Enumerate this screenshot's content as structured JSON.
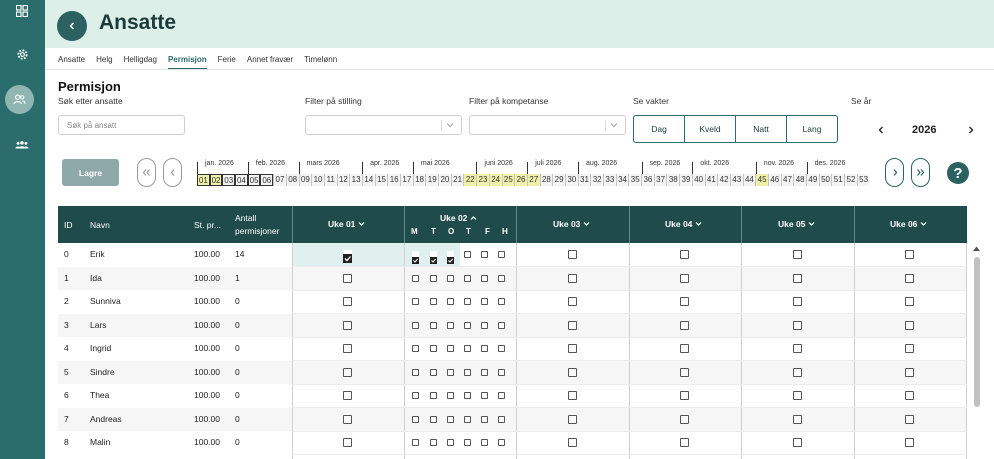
{
  "header": {
    "title": "Ansatte"
  },
  "tabs": [
    "Ansatte",
    "Helg",
    "Helligdag",
    "Permisjon",
    "Ferie",
    "Annet fravær",
    "Timelønn"
  ],
  "active_tab": "Permisjon",
  "section_title": "Permisjon",
  "filters": {
    "search_label": "Søk etter ansatte",
    "search_placeholder": "Søk på ansatt",
    "stilling_label": "Filter på stilling",
    "kompetanse_label": "Filter på kompetanse",
    "vakter_label": "Se vakter",
    "year_label": "Se år"
  },
  "vakter": [
    "Dag",
    "Kveld",
    "Natt",
    "Lang"
  ],
  "year": "2026",
  "save_label": "Lagre",
  "help_label": "?",
  "timeline": {
    "months": [
      "jan. 2026",
      "feb. 2026",
      "mars 2026",
      "apr. 2026",
      "mai 2026",
      "juni 2026",
      "juli 2026",
      "aug. 2026",
      "sep. 2026",
      "okt. 2026",
      "nov. 2026",
      "des. 2026"
    ],
    "month_start_week": [
      1,
      5,
      9,
      14,
      18,
      23,
      27,
      31,
      36,
      40,
      45,
      49
    ],
    "weeks": [
      "01",
      "02",
      "03",
      "04",
      "05",
      "06",
      "07",
      "08",
      "09",
      "10",
      "11",
      "12",
      "13",
      "14",
      "15",
      "16",
      "17",
      "18",
      "19",
      "20",
      "21",
      "22",
      "23",
      "24",
      "25",
      "26",
      "27",
      "28",
      "29",
      "30",
      "31",
      "32",
      "33",
      "34",
      "35",
      "36",
      "37",
      "38",
      "39",
      "40",
      "41",
      "42",
      "43",
      "44",
      "45",
      "46",
      "47",
      "48",
      "49",
      "50",
      "51",
      "52",
      "53"
    ],
    "highlighted_weeks": [
      "01",
      "02",
      "22",
      "23",
      "24",
      "25",
      "26",
      "27",
      "45"
    ],
    "selected_range": [
      "01",
      "06"
    ]
  },
  "table": {
    "col_id": "ID",
    "col_navn": "Navn",
    "col_stilling": "St. pr...",
    "col_antall_1": "Antall",
    "col_antall_2": "permisjoner",
    "weeks": [
      "Uke 01",
      "Uke 02",
      "Uke 03",
      "Uke 04",
      "Uke 05",
      "Uke 06"
    ],
    "expanded_week": "Uke 02",
    "days": [
      "M",
      "T",
      "O",
      "T",
      "F",
      "H"
    ],
    "rows": [
      {
        "id": "0",
        "navn": "Erik",
        "pct": "100.00",
        "antall": "14",
        "uke01": true,
        "uke02_days": [
          true,
          true,
          true,
          false,
          false,
          false
        ]
      },
      {
        "id": "1",
        "navn": "Ida",
        "pct": "100.00",
        "antall": "1",
        "uke01": false,
        "uke02_days": [
          false,
          false,
          false,
          false,
          false,
          false
        ]
      },
      {
        "id": "2",
        "navn": "Sunniva",
        "pct": "100.00",
        "antall": "0",
        "uke01": false,
        "uke02_days": [
          false,
          false,
          false,
          false,
          false,
          false
        ]
      },
      {
        "id": "3",
        "navn": "Lars",
        "pct": "100.00",
        "antall": "0",
        "uke01": false,
        "uke02_days": [
          false,
          false,
          false,
          false,
          false,
          false
        ]
      },
      {
        "id": "4",
        "navn": "Ingrid",
        "pct": "100.00",
        "antall": "0",
        "uke01": false,
        "uke02_days": [
          false,
          false,
          false,
          false,
          false,
          false
        ]
      },
      {
        "id": "5",
        "navn": "Sindre",
        "pct": "100.00",
        "antall": "0",
        "uke01": false,
        "uke02_days": [
          false,
          false,
          false,
          false,
          false,
          false
        ]
      },
      {
        "id": "6",
        "navn": "Thea",
        "pct": "100.00",
        "antall": "0",
        "uke01": false,
        "uke02_days": [
          false,
          false,
          false,
          false,
          false,
          false
        ]
      },
      {
        "id": "7",
        "navn": "Andreas",
        "pct": "100.00",
        "antall": "0",
        "uke01": false,
        "uke02_days": [
          false,
          false,
          false,
          false,
          false,
          false
        ]
      },
      {
        "id": "8",
        "navn": "Malin",
        "pct": "100.00",
        "antall": "0",
        "uke01": false,
        "uke02_days": [
          false,
          false,
          false,
          false,
          false,
          false
        ]
      }
    ]
  },
  "icons": {
    "sidebar": [
      "dashboard-icon",
      "gear-icon",
      "users-icon",
      "group-icon"
    ],
    "accent": "#2b6c6c",
    "header_bg": "#dcefe9",
    "table_header_bg": "#1f4b4b"
  }
}
